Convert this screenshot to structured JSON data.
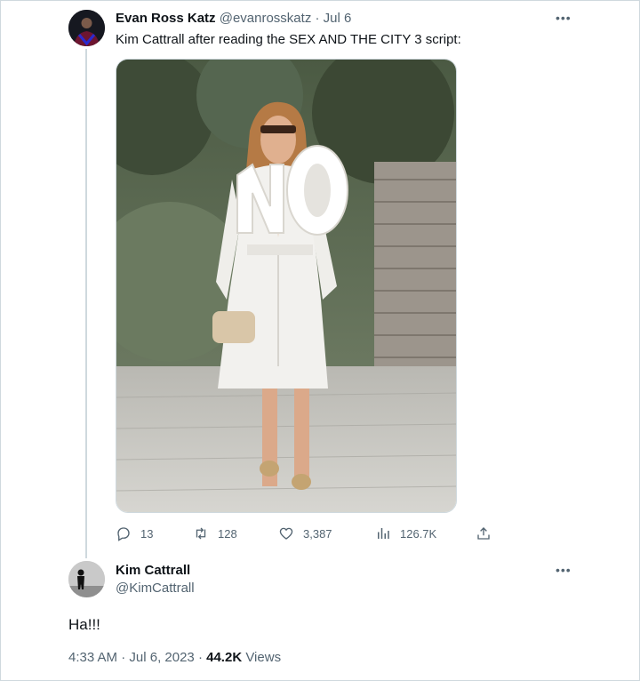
{
  "tweet1": {
    "author_name": "Evan Ross Katz",
    "author_handle": "@evanrosskatz",
    "separator": "·",
    "date": "Jul 6",
    "text": "Kim Cattrall after reading the SEX AND THE CITY 3 script:",
    "media": {
      "description_icon": "photo-woman-in-white-coat-holding-no-sign"
    },
    "actions": {
      "replies": "13",
      "retweets": "128",
      "likes": "3,387",
      "views": "126.7K"
    }
  },
  "tweet2": {
    "author_name": "Kim Cattrall",
    "author_handle": "@KimCattrall",
    "text": "Ha!!!",
    "time": "4:33 AM",
    "separator": "·",
    "date": "Jul 6, 2023",
    "views_count": "44.2K",
    "views_label": "Views"
  },
  "colors": {
    "text_primary": "#0f1419",
    "text_secondary": "#536471",
    "border": "#cfd9de"
  }
}
